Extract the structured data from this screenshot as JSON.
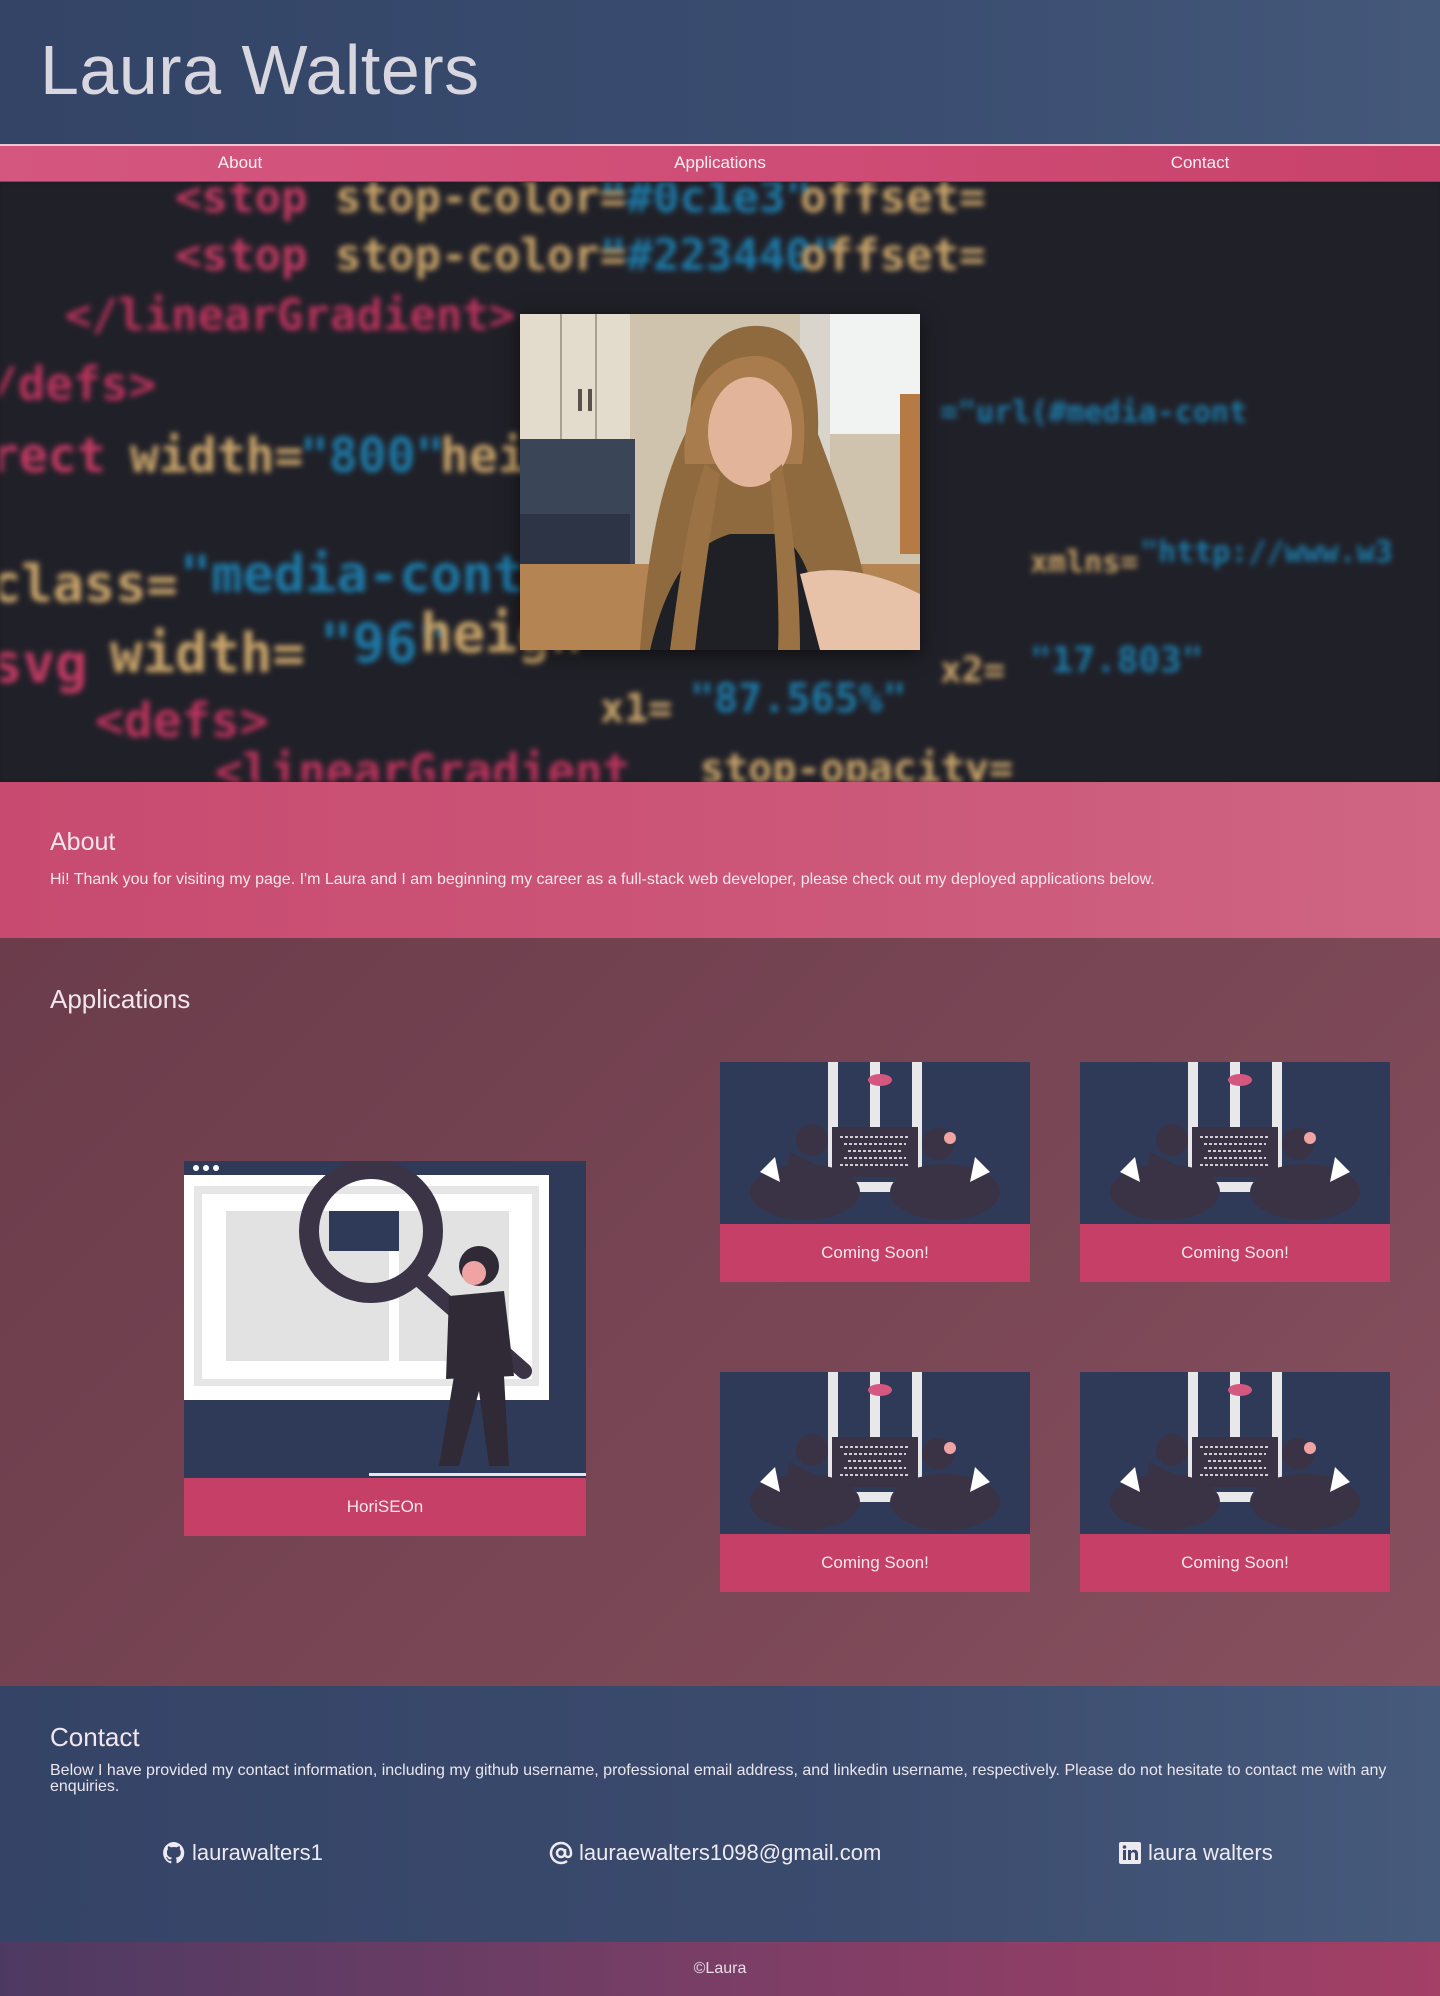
{
  "header": {
    "title": "Laura Walters"
  },
  "nav": {
    "items": [
      {
        "label": "About"
      },
      {
        "label": "Applications"
      },
      {
        "label": "Contact"
      }
    ]
  },
  "about": {
    "heading": "About",
    "text": "Hi! Thank you for visiting my page. I'm Laura and I am beginning my career as a full-stack web developer, please check out my deployed applications below."
  },
  "applications": {
    "heading": "Applications",
    "featured": {
      "label": "HoriSEOn"
    },
    "cards": [
      {
        "label": "Coming Soon!"
      },
      {
        "label": "Coming Soon!"
      },
      {
        "label": "Coming Soon!"
      },
      {
        "label": "Coming Soon!"
      }
    ]
  },
  "contact": {
    "heading": "Contact",
    "text": "Below I have provided my contact information, including my github username, professional email address, and linkedin username, respectively. Please do not hesitate to contact me with any enquiries.",
    "github": "laurawalters1",
    "email": "lauraewalters1098@gmail.com",
    "linkedin": "laura walters"
  },
  "footer": {
    "text": "©Laura"
  },
  "colors": {
    "accent": "#c63f66",
    "navy": "#344366",
    "plum": "#7a4756"
  }
}
